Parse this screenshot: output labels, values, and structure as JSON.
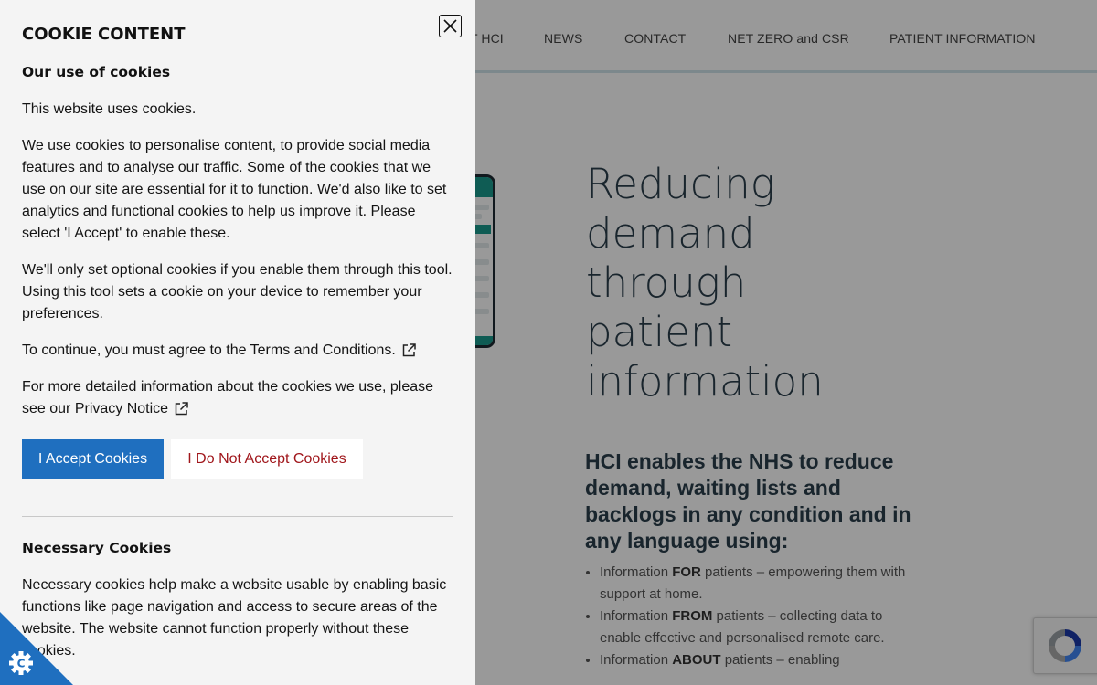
{
  "nav": {
    "items": [
      "T HCI",
      "NEWS",
      "CONTACT",
      "NET ZERO and CSR",
      "PATIENT INFORMATION"
    ]
  },
  "hero": {
    "title_lines": [
      "Reducing",
      "demand",
      "through",
      "patient",
      "information"
    ],
    "subheading": "HCI enables the NHS to reduce demand, waiting lists and backlogs in any condition and in any language using:",
    "list": [
      {
        "pre": "Information ",
        "bold": "FOR",
        "post": " patients – empowering them with support at home."
      },
      {
        "pre": "Information ",
        "bold": "FROM",
        "post": " patients – collecting data to enable effective and personalised remote care."
      },
      {
        "pre": "Information ",
        "bold": "ABOUT",
        "post": " patients – enabling"
      }
    ]
  },
  "cookie_panel": {
    "title": "COOKIE CONTENT",
    "close_label": "Close",
    "section_heading": "Our use of cookies",
    "para1": "This website uses cookies.",
    "para2": "We use cookies to personalise content, to provide social media features and to analyse our traffic. Some of the cookies that we use on our site are essential for it to function. We'd also like to set analytics and functional cookies to help us improve it. Please select 'I Accept' to enable these.",
    "para3": "We'll only set optional cookies if you enable them through this tool. Using this tool sets a cookie on your device to remember your preferences.",
    "para4_prefix": "To continue, you must agree to the ",
    "terms_link": "Terms and Conditions.",
    "para5_prefix": "For more detailed information about the cookies we use, please see our ",
    "privacy_link": "Privacy Notice",
    "accept_label": "I Accept Cookies",
    "reject_label": "I Do Not Accept Cookies",
    "necessary_heading": "Necessary Cookies",
    "necessary_text": "Necessary cookies help make a website usable by enabling basic functions like page navigation and access to secure areas of the website. The website cannot function properly without these cookies."
  },
  "colors": {
    "accept": "#1f6fbf",
    "reject_text": "#a0161b",
    "badge": "#1f6fbf",
    "accent_teal": "#1a9a8c"
  },
  "icons": [
    "close-icon",
    "external-link-icon",
    "cookie-gear-icon",
    "recaptcha-icon"
  ]
}
